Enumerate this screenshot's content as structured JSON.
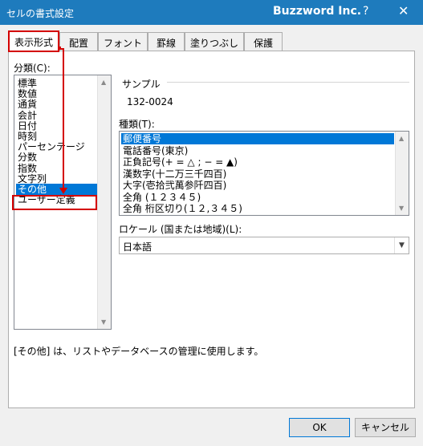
{
  "window": {
    "title": "セルの書式設定",
    "brand": "Buzzword Inc.",
    "help": "?",
    "close": "✕"
  },
  "tabs": [
    "表示形式",
    "配置",
    "フォント",
    "罫線",
    "塗りつぶし",
    "保護"
  ],
  "category": {
    "label": "分類(C):",
    "items": [
      "標準",
      "数値",
      "通貨",
      "会計",
      "日付",
      "時刻",
      "パーセンテージ",
      "分数",
      "指数",
      "文字列",
      "その他",
      "ユーザー定義"
    ],
    "selected_index": 10
  },
  "sample": {
    "label": "サンプル",
    "value": "132-0024"
  },
  "type": {
    "label": "種類(T):",
    "items": [
      "郵便番号",
      "電話番号(東京)",
      "正負記号(+ = △ ; − = ▲)",
      "漢数字(十二万三千四百)",
      "大字(壱拾弐萬参阡四百)",
      "全角 (１２３４５)",
      "全角 桁区切り(１２,３４５)"
    ],
    "selected_index": 0
  },
  "locale": {
    "label": "ロケール (国または地域)(L):",
    "value": "日本語"
  },
  "description": "[その他] は、リストやデータベースの管理に使用します。",
  "buttons": {
    "ok": "OK",
    "cancel": "キャンセル"
  },
  "colors": {
    "titlebar": "#1e7bbd",
    "selection": "#0078d7",
    "annotation": "#d40000"
  }
}
